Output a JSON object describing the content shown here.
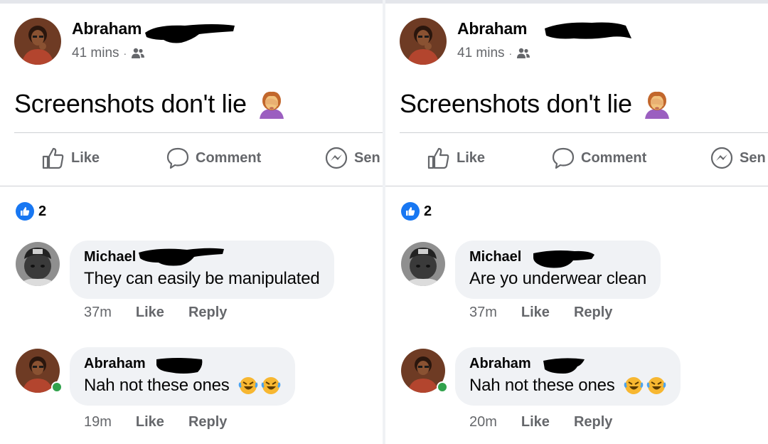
{
  "panels": [
    {
      "post": {
        "author": "Abraham",
        "time": "41 mins",
        "separator": "·",
        "audience_icon": "friends-icon",
        "text": "Screenshots don't lie",
        "emoji": "woman-facepalming-emoji"
      },
      "actions": {
        "like": "Like",
        "comment": "Comment",
        "send": "Sen"
      },
      "reactions": {
        "type": "like",
        "count": "2"
      },
      "comments": [
        {
          "author": "Michael",
          "text": "They can easily be manipulated",
          "time": "37m",
          "like": "Like",
          "reply": "Reply"
        },
        {
          "author": "Abraham",
          "text": "Nah not these ones",
          "emoji": "rolling-on-floor-laughing-emoji",
          "time": "19m",
          "like": "Like",
          "reply": "Reply"
        }
      ]
    },
    {
      "post": {
        "author": "Abraham",
        "time": "41 mins",
        "separator": "·",
        "audience_icon": "friends-icon",
        "text": "Screenshots don't lie",
        "emoji": "woman-facepalming-emoji"
      },
      "actions": {
        "like": "Like",
        "comment": "Comment",
        "send": "Sen"
      },
      "reactions": {
        "type": "like",
        "count": "2"
      },
      "comments": [
        {
          "author": "Michael",
          "text": "Are yo underwear clean",
          "time": "37m",
          "like": "Like",
          "reply": "Reply"
        },
        {
          "author": "Abraham",
          "text": "Nah not these ones",
          "emoji": "rolling-on-floor-laughing-emoji",
          "time": "20m",
          "like": "Like",
          "reply": "Reply"
        }
      ]
    }
  ],
  "colors": {
    "brand_blue": "#1877f2",
    "secondary_text": "#65676b",
    "bubble_bg": "#f0f2f5",
    "online_green": "#31a24c"
  }
}
